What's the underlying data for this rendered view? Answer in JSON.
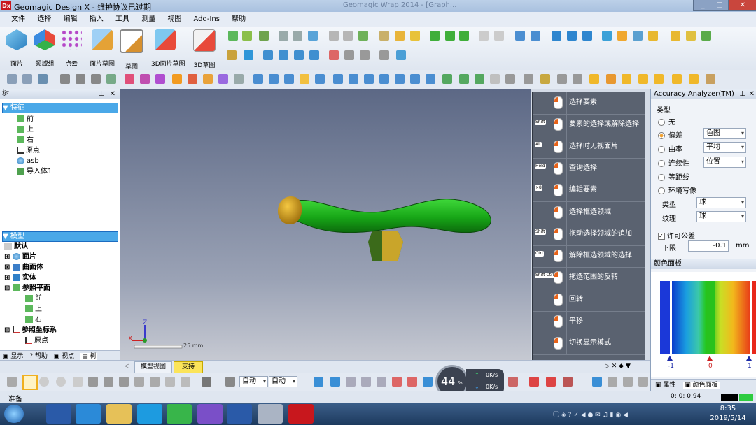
{
  "titlebar": {
    "logo": "Dx",
    "title": "Geomagic Design X - 维护协议已过期",
    "bg_title": "Geomagic Wrap 2014 - [Graph..."
  },
  "menu": [
    "文件",
    "选择",
    "编辑",
    "插入",
    "工具",
    "测量",
    "视图",
    "Add-Ins",
    "帮助"
  ],
  "ribbon": {
    "big_tools": [
      "面片",
      "领域组",
      "点云",
      "面片草图",
      "草图",
      "3D面片草图",
      "3D草图"
    ]
  },
  "tree": {
    "header": "树",
    "features_label": "特征",
    "features": [
      "前",
      "上",
      "右",
      "原点",
      "asb",
      "导入体1"
    ],
    "model_header": "模型",
    "model_items": [
      "默认",
      "面片",
      "曲面体",
      "实体",
      "参照平面",
      "前",
      "上",
      "右",
      "参照坐标系",
      "原点"
    ]
  },
  "left_tabs": [
    "显示",
    "帮助",
    "视点",
    "树"
  ],
  "viewport": {
    "scale_label": "25 mm",
    "axis_z": "Z",
    "axis_x": "X"
  },
  "selection_help": [
    {
      "key": "",
      "text": "选择要素"
    },
    {
      "key": "Shift",
      "text": "要素的选择或解除选择"
    },
    {
      "key": "Alt",
      "text": "选择时无视面片"
    },
    {
      "key": "Hold",
      "text": "查询选择"
    },
    {
      "key": "×8",
      "text": "编辑要素"
    },
    {
      "key": "",
      "text": "选择框选领域"
    },
    {
      "key": "Shift",
      "text": "拖动选择领域的追加"
    },
    {
      "key": "Ctrl",
      "text": "解除框选领域的选择"
    },
    {
      "key": "Shift Ctrl",
      "text": "拖选范围的反转"
    },
    {
      "key": "",
      "text": "回转"
    },
    {
      "key": "",
      "text": "平移"
    },
    {
      "key": "",
      "text": "切换显示模式"
    }
  ],
  "accuracy": {
    "title": "Accuracy Analyzer(TM)",
    "type_label": "类型",
    "options": [
      "无",
      "偏差",
      "曲率",
      "连续性",
      "等距线",
      "环境写像"
    ],
    "selected": "偏差",
    "dropdowns": [
      "色图",
      "平均",
      "位置"
    ],
    "type2_label": "类型",
    "type2_value": "球",
    "texture_label": "纹理",
    "texture_value": "球",
    "tolerance_label": "许可公差",
    "lower_label": "下限",
    "lower_value": "-0.1",
    "unit": "mm",
    "color_panel_title": "颜色面板",
    "ticks": [
      "-1",
      "0",
      "1"
    ],
    "tabs": [
      "属性",
      "颜色面板"
    ]
  },
  "bottom_tabs": [
    "模型视图",
    "支持"
  ],
  "toolbar3": {
    "dd1": "自动",
    "dd2": "自动"
  },
  "speed": {
    "percent": "44",
    "unit": "%",
    "up": "0K/s",
    "down": "0K/s"
  },
  "status": {
    "left": "准备",
    "right": "0: 0: 0.94"
  },
  "clock": {
    "time": "8:35",
    "date": "2019/5/14"
  },
  "colors": {
    "accent": "#4aa8e8",
    "model_green": "#22b51e",
    "handle_gold": "#d9a51c"
  }
}
